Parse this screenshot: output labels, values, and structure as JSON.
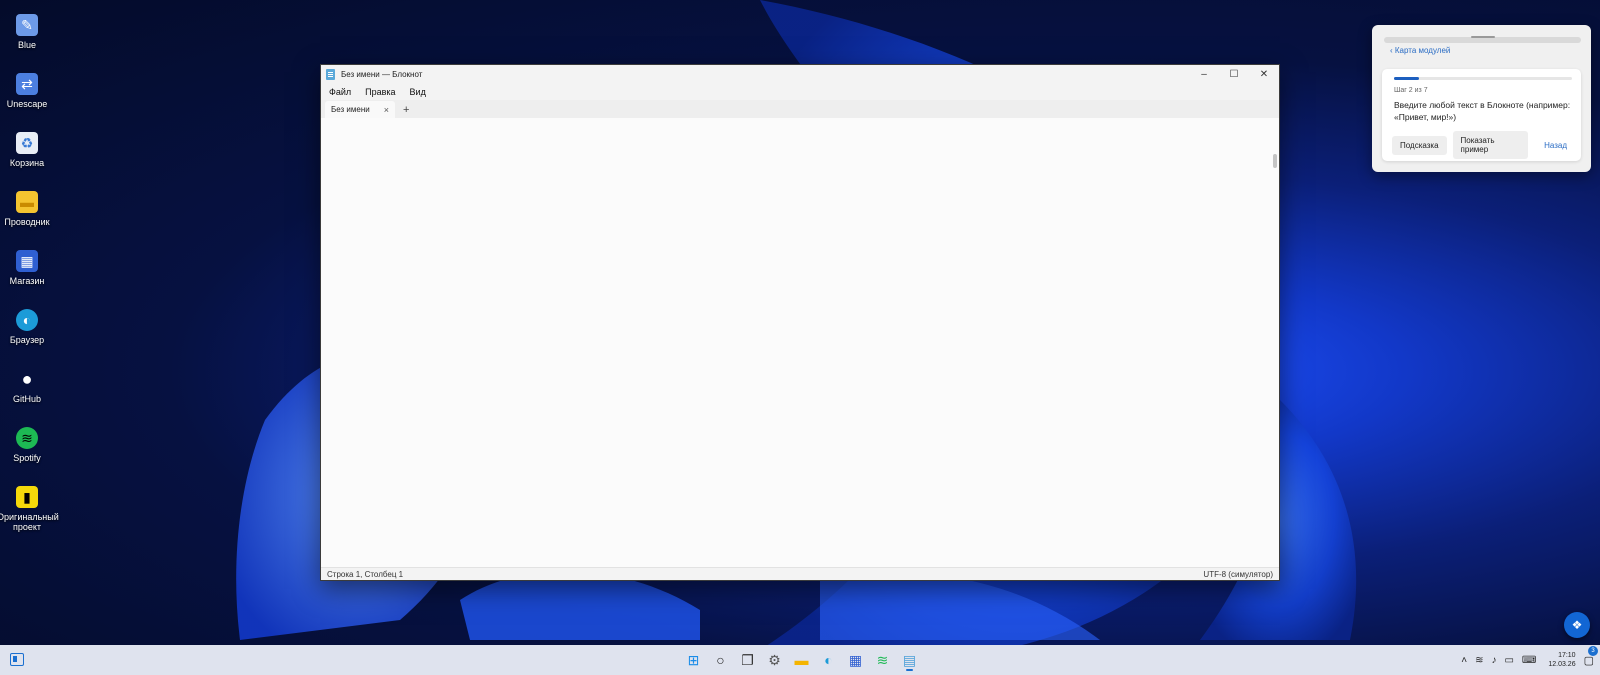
{
  "desktop": {
    "icons": [
      {
        "label": "Blue",
        "icon": "blue-app-icon",
        "color": "#6d9ae8",
        "glyph": "✎"
      },
      {
        "label": "Unescape",
        "icon": "unescape-icon",
        "color": "#4c7fe0",
        "glyph": "⇄"
      },
      {
        "label": "Корзина",
        "icon": "recycle-bin-icon",
        "color": "#e9eef6",
        "glyph": "♻"
      },
      {
        "label": "Проводник",
        "icon": "folder-icon",
        "color": "#f4c430",
        "glyph": "▬"
      },
      {
        "label": "Магазин",
        "icon": "store-icon",
        "color": "#2f5fd1",
        "glyph": "▦"
      },
      {
        "label": "Браузер",
        "icon": "edge-browser-icon",
        "color": "#1c9bd8",
        "glyph": "◐"
      },
      {
        "label": "GitHub",
        "icon": "github-icon",
        "color": "#ffffff",
        "glyph": "●"
      },
      {
        "label": "Spotify",
        "icon": "spotify-icon",
        "color": "#1db954",
        "glyph": "≋"
      },
      {
        "label": "Оригинальный проект",
        "icon": "original-project-icon",
        "color": "#f5d90a",
        "glyph": "▮"
      }
    ]
  },
  "notepad": {
    "title": "Без имени — Блокнот",
    "menu": [
      "Файл",
      "Правка",
      "Вид"
    ],
    "tab": {
      "label": "Без имени",
      "close": "×"
    },
    "new_tab": "+",
    "controls": {
      "minimize": "–",
      "maximize": "☐",
      "close": "✕"
    },
    "status": {
      "position": "Строка 1, Столбец 1",
      "encoding": "UTF-8 (симулятор)"
    }
  },
  "tutorial": {
    "back_link": "‹ Карта модулей",
    "progress": 0.143,
    "step": "Шаг 2 из 7",
    "instruction": "Введите любой текст в Блокноте (например: «Привет, мир!»)",
    "buttons": {
      "hint": "Подсказка",
      "example": "Показать пример",
      "back": "Назад"
    }
  },
  "taskbar": {
    "apps": [
      {
        "name": "start",
        "icon": "windows-start-icon",
        "glyph": "⊞",
        "color": "#1a8ce8"
      },
      {
        "name": "search",
        "icon": "search-icon",
        "glyph": "○",
        "color": "#222222"
      },
      {
        "name": "task-view",
        "icon": "task-view-icon",
        "glyph": "❐",
        "color": "#333333"
      },
      {
        "name": "settings",
        "icon": "settings-gear-icon",
        "glyph": "⚙",
        "color": "#555555"
      },
      {
        "name": "explorer",
        "icon": "folder-icon",
        "glyph": "▬",
        "color": "#f4b400"
      },
      {
        "name": "browser",
        "icon": "edge-browser-icon",
        "glyph": "◐",
        "color": "#1c9bd8"
      },
      {
        "name": "store",
        "icon": "store-icon",
        "glyph": "▦",
        "color": "#2f5fd1"
      },
      {
        "name": "spotify",
        "icon": "spotify-icon",
        "glyph": "≋",
        "color": "#1db954"
      },
      {
        "name": "notepad",
        "icon": "notepad-icon",
        "glyph": "▤",
        "color": "#4a9fd8",
        "active": true
      }
    ],
    "tray": {
      "time": "17:10",
      "date": "12.03.26",
      "notifications": "3"
    }
  },
  "colors": {
    "accent": "#1a6fd0",
    "link": "#2a6cc4",
    "progress": "#1d5fbf"
  }
}
